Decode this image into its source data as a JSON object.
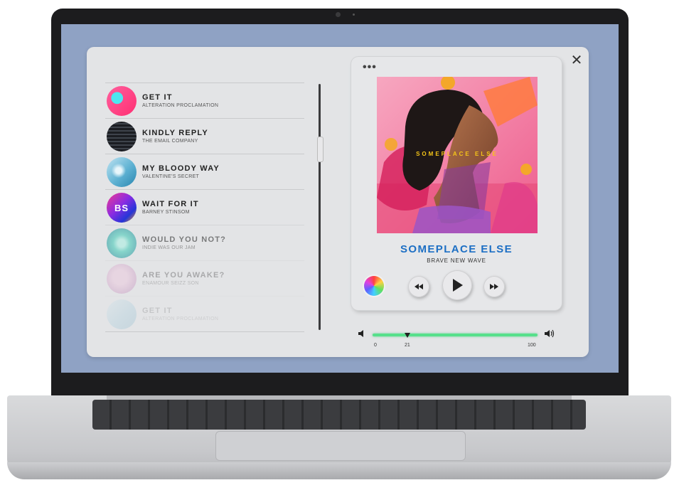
{
  "tracks": [
    {
      "title": "GET IT",
      "artist": "ALTERATION PROCLAMATION"
    },
    {
      "title": "KINDLY REPLY",
      "artist": "THE EMAIL COMPANY"
    },
    {
      "title": "MY BLOODY WAY",
      "artist": "VALENTINE'S SECRET"
    },
    {
      "title": "WAIT FOR IT",
      "artist": "BARNEY STINSOM"
    },
    {
      "title": "WOULD YOU NOT?",
      "artist": "INDIE WAS OUR JAM"
    },
    {
      "title": "ARE YOU AWAKE?",
      "artist": "ENAMOUR SEIZZ SON"
    },
    {
      "title": "GET IT",
      "artist": "ALTERATION PROCLAMATION"
    }
  ],
  "covers": {
    "wait_for_it_text": "BS"
  },
  "player": {
    "more_glyph": "•••",
    "close_glyph": "✕",
    "album_text": "SOMEPLACE ELSE",
    "song_title": "SOMEPLACE ELSE",
    "song_artist": "BRAVE NEW WAVE"
  },
  "volume": {
    "min_label": "0",
    "current_label": "21",
    "max_label": "100",
    "current_value": 21,
    "accent_color": "#57e08b"
  },
  "colors": {
    "title_blue": "#1d6fc4",
    "desktop_bg": "#8fa2c4"
  }
}
